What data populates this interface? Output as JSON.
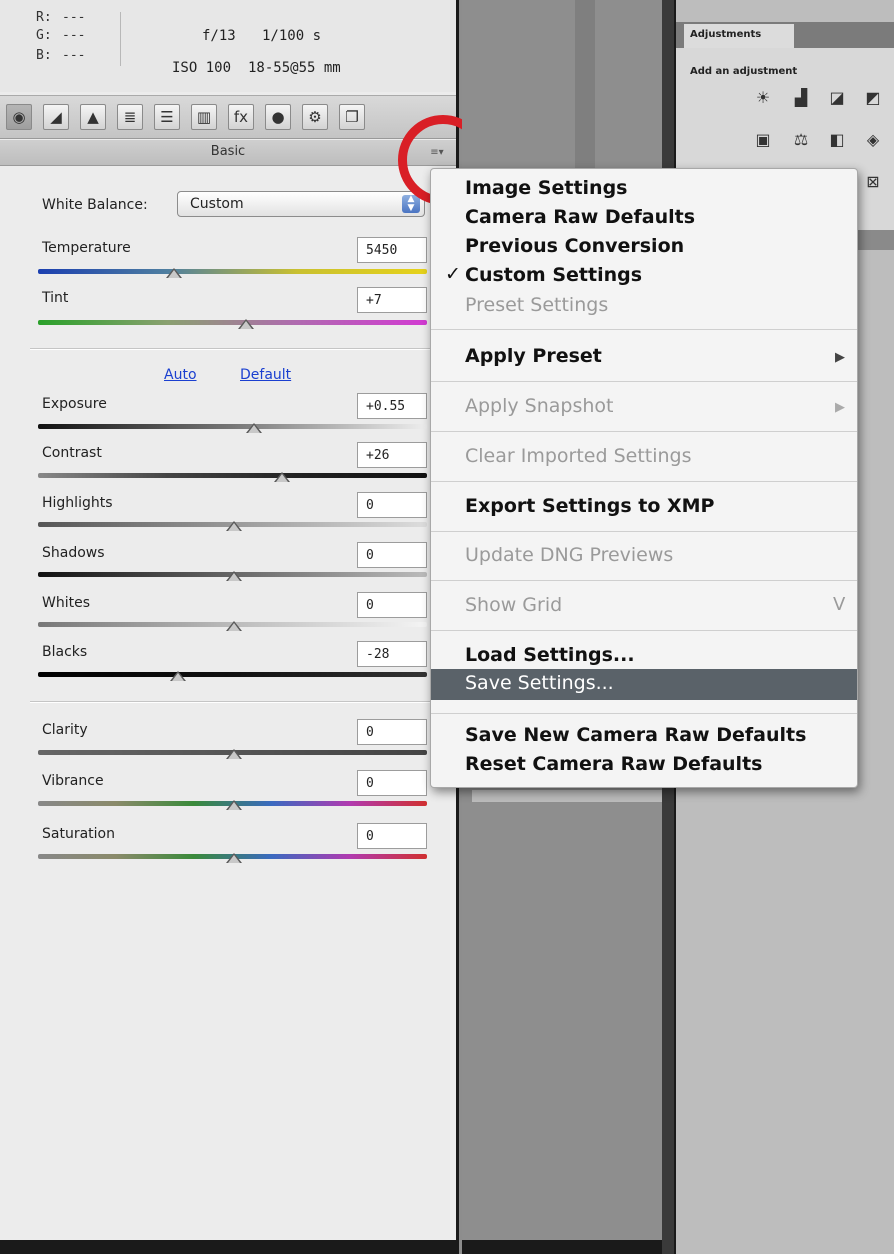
{
  "info": {
    "r_label": "R:",
    "r_value": "---",
    "g_label": "G:",
    "g_value": "---",
    "b_label": "B:",
    "b_value": "---",
    "aperture": "f/13",
    "shutter": "1/100 s",
    "iso": "ISO 100",
    "lens": "18-55@55 mm"
  },
  "panel": {
    "title": "Basic",
    "menu_icon": "≡▾"
  },
  "toolbar_tabs": [
    {
      "icon": "aperture-icon",
      "glyph": "◉"
    },
    {
      "icon": "tone-curve-icon",
      "glyph": "◢"
    },
    {
      "icon": "detail-icon",
      "glyph": "▲"
    },
    {
      "icon": "hsl-icon",
      "glyph": "≣"
    },
    {
      "icon": "split-toning-icon",
      "glyph": "☰"
    },
    {
      "icon": "lens-corrections-icon",
      "glyph": "▥"
    },
    {
      "icon": "effects-icon",
      "glyph": "fx"
    },
    {
      "icon": "camera-calibration-icon",
      "glyph": "●"
    },
    {
      "icon": "presets-icon",
      "glyph": "⚙"
    },
    {
      "icon": "snapshots-icon",
      "glyph": "❐"
    }
  ],
  "white_balance": {
    "label": "White Balance:",
    "value": "Custom"
  },
  "links": {
    "auto": "Auto",
    "default": "Default"
  },
  "sliders": {
    "temperature": {
      "label": "Temperature",
      "value": "5450"
    },
    "tint": {
      "label": "Tint",
      "value": "+7"
    },
    "exposure": {
      "label": "Exposure",
      "value": "+0.55"
    },
    "contrast": {
      "label": "Contrast",
      "value": "+26"
    },
    "highlights": {
      "label": "Highlights",
      "value": "0"
    },
    "shadows": {
      "label": "Shadows",
      "value": "0"
    },
    "whites": {
      "label": "Whites",
      "value": "0"
    },
    "blacks": {
      "label": "Blacks",
      "value": "-28"
    },
    "clarity": {
      "label": "Clarity",
      "value": "0"
    },
    "vibrance": {
      "label": "Vibrance",
      "value": "0"
    },
    "saturation": {
      "label": "Saturation",
      "value": "0"
    }
  },
  "menu": {
    "image_settings": "Image Settings",
    "camera_raw_defaults": "Camera Raw Defaults",
    "previous_conversion": "Previous Conversion",
    "custom_settings": "Custom Settings",
    "checkmark": "✓",
    "preset_settings": "Preset Settings",
    "apply_preset": "Apply Preset",
    "apply_snapshot": "Apply Snapshot",
    "clear_imported": "Clear Imported Settings",
    "export_xmp": "Export Settings to XMP",
    "update_dng": "Update DNG Previews",
    "show_grid": "Show Grid",
    "show_grid_shortcut": "V",
    "load_settings": "Load Settings...",
    "save_settings": "Save Settings...",
    "save_new_defaults": "Save New Camera Raw Defaults",
    "reset_defaults": "Reset Camera Raw Defaults",
    "submenu_arrow": "▶"
  },
  "adjustments": {
    "tab": "Adjustments",
    "add_label": "Add an adjustment"
  },
  "colors": {
    "highlight_circle": "#d91f26",
    "menu_selected": "#5a6269",
    "link": "#1a3fd0"
  }
}
